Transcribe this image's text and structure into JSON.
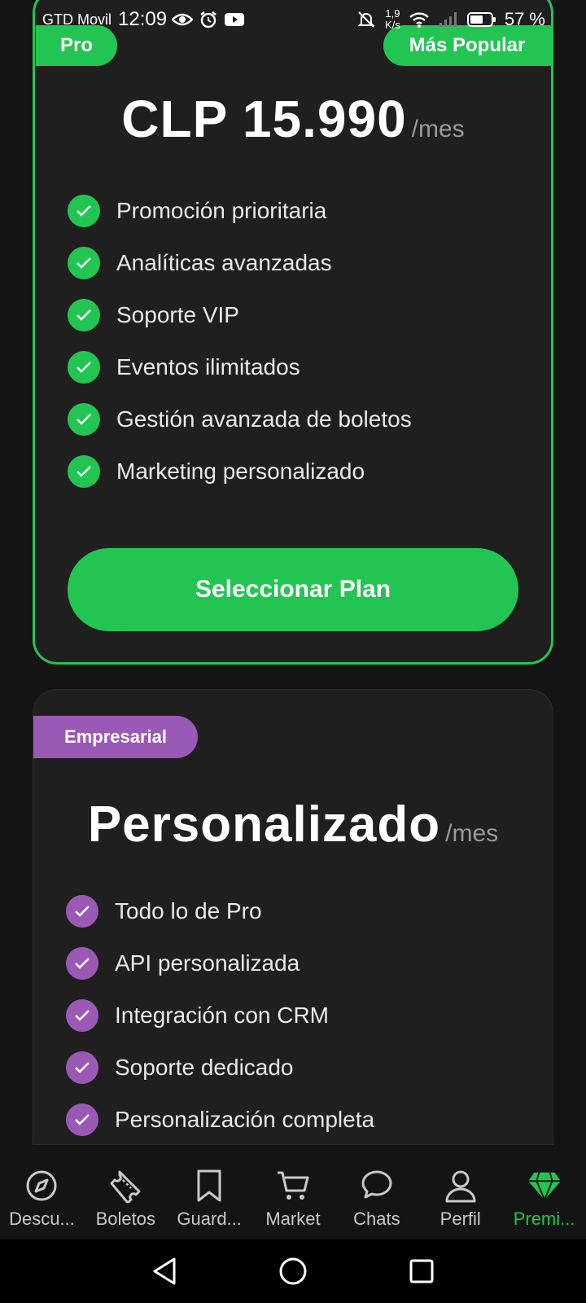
{
  "status_bar": {
    "carrier": "GTD Movil",
    "time": "12:09",
    "net_speed_value": "1,9",
    "net_speed_unit": "K/s",
    "battery": "57 %"
  },
  "pro_plan": {
    "badge": "Pro",
    "popular_badge": "Más Popular",
    "price": "CLP 15.990",
    "period": "/mes",
    "features": [
      "Promoción prioritaria",
      "Analíticas avanzadas",
      "Soporte VIP",
      "Eventos ilimitados",
      "Gestión avanzada de boletos",
      "Marketing personalizado"
    ],
    "button": "Seleccionar Plan"
  },
  "enterprise_plan": {
    "badge": "Empresarial",
    "price": "Personalizado",
    "period": "/mes",
    "features": [
      "Todo lo de Pro",
      "API personalizada",
      "Integración con CRM",
      "Soporte dedicado",
      "Personalización completa"
    ]
  },
  "bottom_nav": {
    "items": [
      {
        "label": "Descu...",
        "icon": "compass-icon"
      },
      {
        "label": "Boletos",
        "icon": "ticket-icon"
      },
      {
        "label": "Guard...",
        "icon": "bookmark-icon"
      },
      {
        "label": "Market",
        "icon": "cart-icon"
      },
      {
        "label": "Chats",
        "icon": "chat-icon"
      },
      {
        "label": "Perfil",
        "icon": "user-icon"
      },
      {
        "label": "Premi...",
        "icon": "diamond-icon",
        "active": true
      }
    ]
  },
  "colors": {
    "accent_green": "#23c552",
    "accent_purple": "#9b59b6",
    "card_bg": "#1f1f1f",
    "page_bg": "#141414"
  }
}
